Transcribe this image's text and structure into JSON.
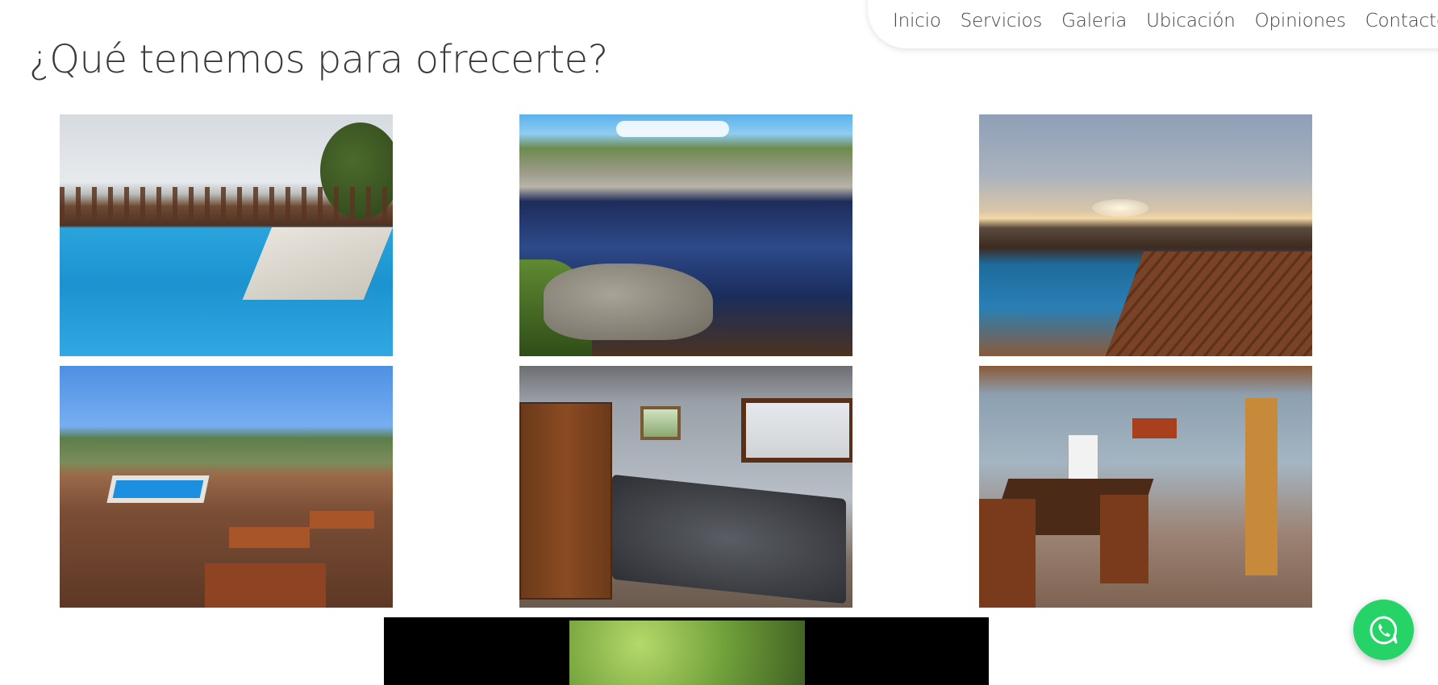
{
  "nav": {
    "items": [
      "Inicio",
      "Servicios",
      "Galeria",
      "Ubicación",
      "Opiniones",
      "Contacto"
    ]
  },
  "section": {
    "title": "¿Qué tenemos para ofrecerte?"
  },
  "gallery": {
    "photos": [
      {
        "name": "pool-photo"
      },
      {
        "name": "river-photo"
      },
      {
        "name": "sunset-deck-photo"
      },
      {
        "name": "deck-loungers-photo"
      },
      {
        "name": "bedroom-photo"
      },
      {
        "name": "kitchen-dining-photo"
      }
    ]
  },
  "colors": {
    "whatsapp": "#25d366",
    "nav_text": "#444444",
    "title_text": "#3a3a3a"
  },
  "icons": {
    "whatsapp_button": "whatsapp-icon"
  }
}
